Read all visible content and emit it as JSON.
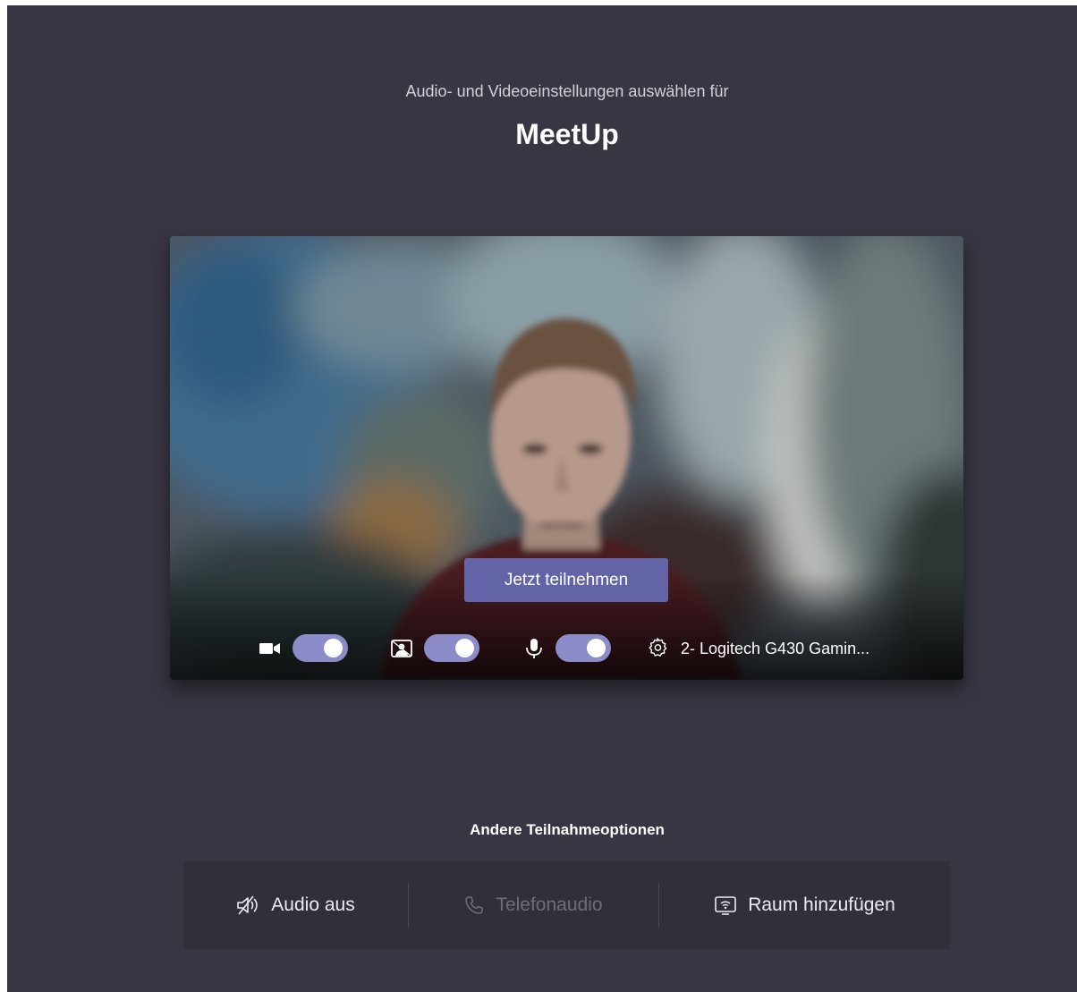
{
  "header": {
    "subtitle": "Audio- und Videoeinstellungen auswählen für",
    "title": "MeetUp"
  },
  "preview": {
    "join_label": "Jetzt teilnehmen",
    "camera_on": true,
    "background_blur_on": true,
    "microphone_on": true,
    "device_label": "2- Logitech G430 Gamin..."
  },
  "other_options": {
    "title": "Andere Teilnahmeoptionen",
    "audio_off_label": "Audio aus",
    "phone_audio_label": "Telefonaudio",
    "add_room_label": "Raum hinzufügen"
  },
  "colors": {
    "background": "#373642",
    "accent": "#6264a7",
    "toggle_on": "#8b8cc7",
    "options_panel": "#302f3a"
  }
}
